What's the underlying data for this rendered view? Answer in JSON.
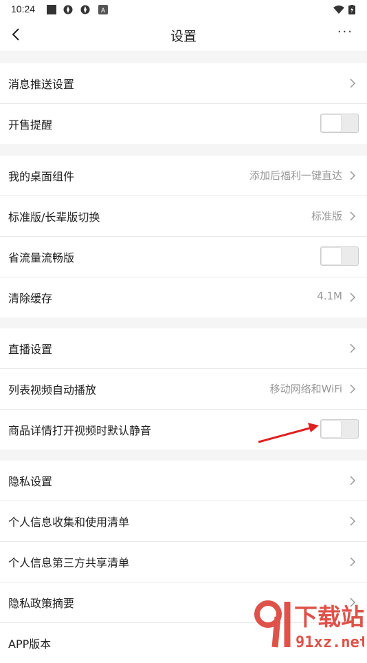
{
  "status_bar": {
    "time": "10:24"
  },
  "header": {
    "title": "设置"
  },
  "groups": [
    {
      "items": [
        {
          "label": "消息推送设置",
          "value": "",
          "type": "chevron"
        },
        {
          "label": "开售提醒",
          "value": "",
          "type": "toggle",
          "on": false
        }
      ]
    },
    {
      "items": [
        {
          "label": "我的桌面组件",
          "value": "添加后福利一键直达",
          "type": "chevron"
        },
        {
          "label": "标准版/长辈版切换",
          "value": "标准版",
          "type": "chevron"
        },
        {
          "label": "省流量流畅版",
          "value": "",
          "type": "toggle",
          "on": false
        },
        {
          "label": "清除缓存",
          "value": "4.1M",
          "type": "chevron"
        }
      ]
    },
    {
      "items": [
        {
          "label": "直播设置",
          "value": "",
          "type": "chevron"
        },
        {
          "label": "列表视频自动播放",
          "value": "移动网络和WiFi",
          "type": "chevron"
        },
        {
          "label": "商品详情打开视频时默认静音",
          "value": "",
          "type": "toggle",
          "on": false
        }
      ]
    },
    {
      "items": [
        {
          "label": "隐私设置",
          "value": "",
          "type": "chevron"
        },
        {
          "label": "个人信息收集和使用清单",
          "value": "",
          "type": "chevron"
        },
        {
          "label": "个人信息第三方共享清单",
          "value": "",
          "type": "chevron"
        },
        {
          "label": "隐私政策摘要",
          "value": "",
          "type": "chevron"
        },
        {
          "label": "APP版本",
          "value": "",
          "type": "none"
        }
      ]
    }
  ],
  "watermark": {
    "line1": "下载站",
    "line2": "91xz.net"
  },
  "colors": {
    "annotation_arrow": "#e02020",
    "watermark": "#d9342b"
  }
}
